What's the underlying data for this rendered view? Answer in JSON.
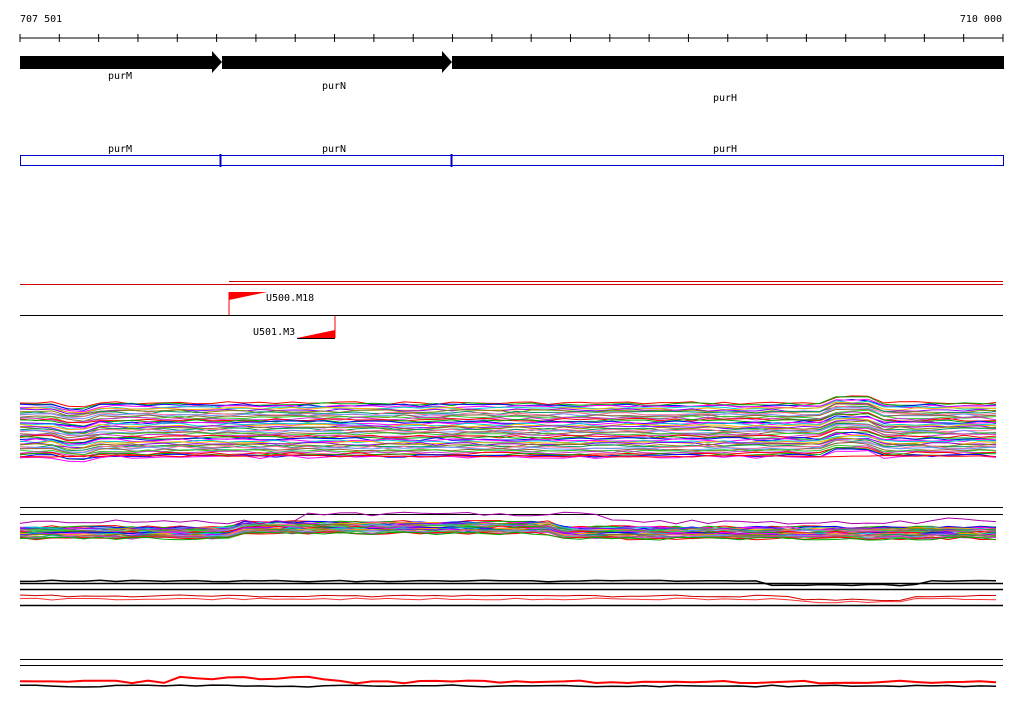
{
  "ruler": {
    "start_label": "707 501",
    "end_label": "710 000"
  },
  "genes": [
    {
      "name": "purM",
      "strand": "+"
    },
    {
      "name": "purN",
      "strand": "+"
    },
    {
      "name": "purH",
      "strand": "+"
    }
  ],
  "annotation_track": {
    "labels": [
      "purM",
      "purN",
      "purH"
    ],
    "color": "#0000cc"
  },
  "features": [
    {
      "name": "U500.M18",
      "color": "#ff0000"
    },
    {
      "name": "U501.M3",
      "color": "#ff0000"
    }
  ],
  "colors": {
    "gene_arrow": "#000000",
    "feature_line": "#cc0000",
    "palette": [
      "#ff0000",
      "#00aa00",
      "#0000ff",
      "#ff00ff",
      "#00cccc",
      "#ffaa00",
      "#8800ff",
      "#888800",
      "#009966",
      "#ff6699",
      "#6699ff",
      "#996633",
      "#33cc33",
      "#cc33cc"
    ]
  }
}
